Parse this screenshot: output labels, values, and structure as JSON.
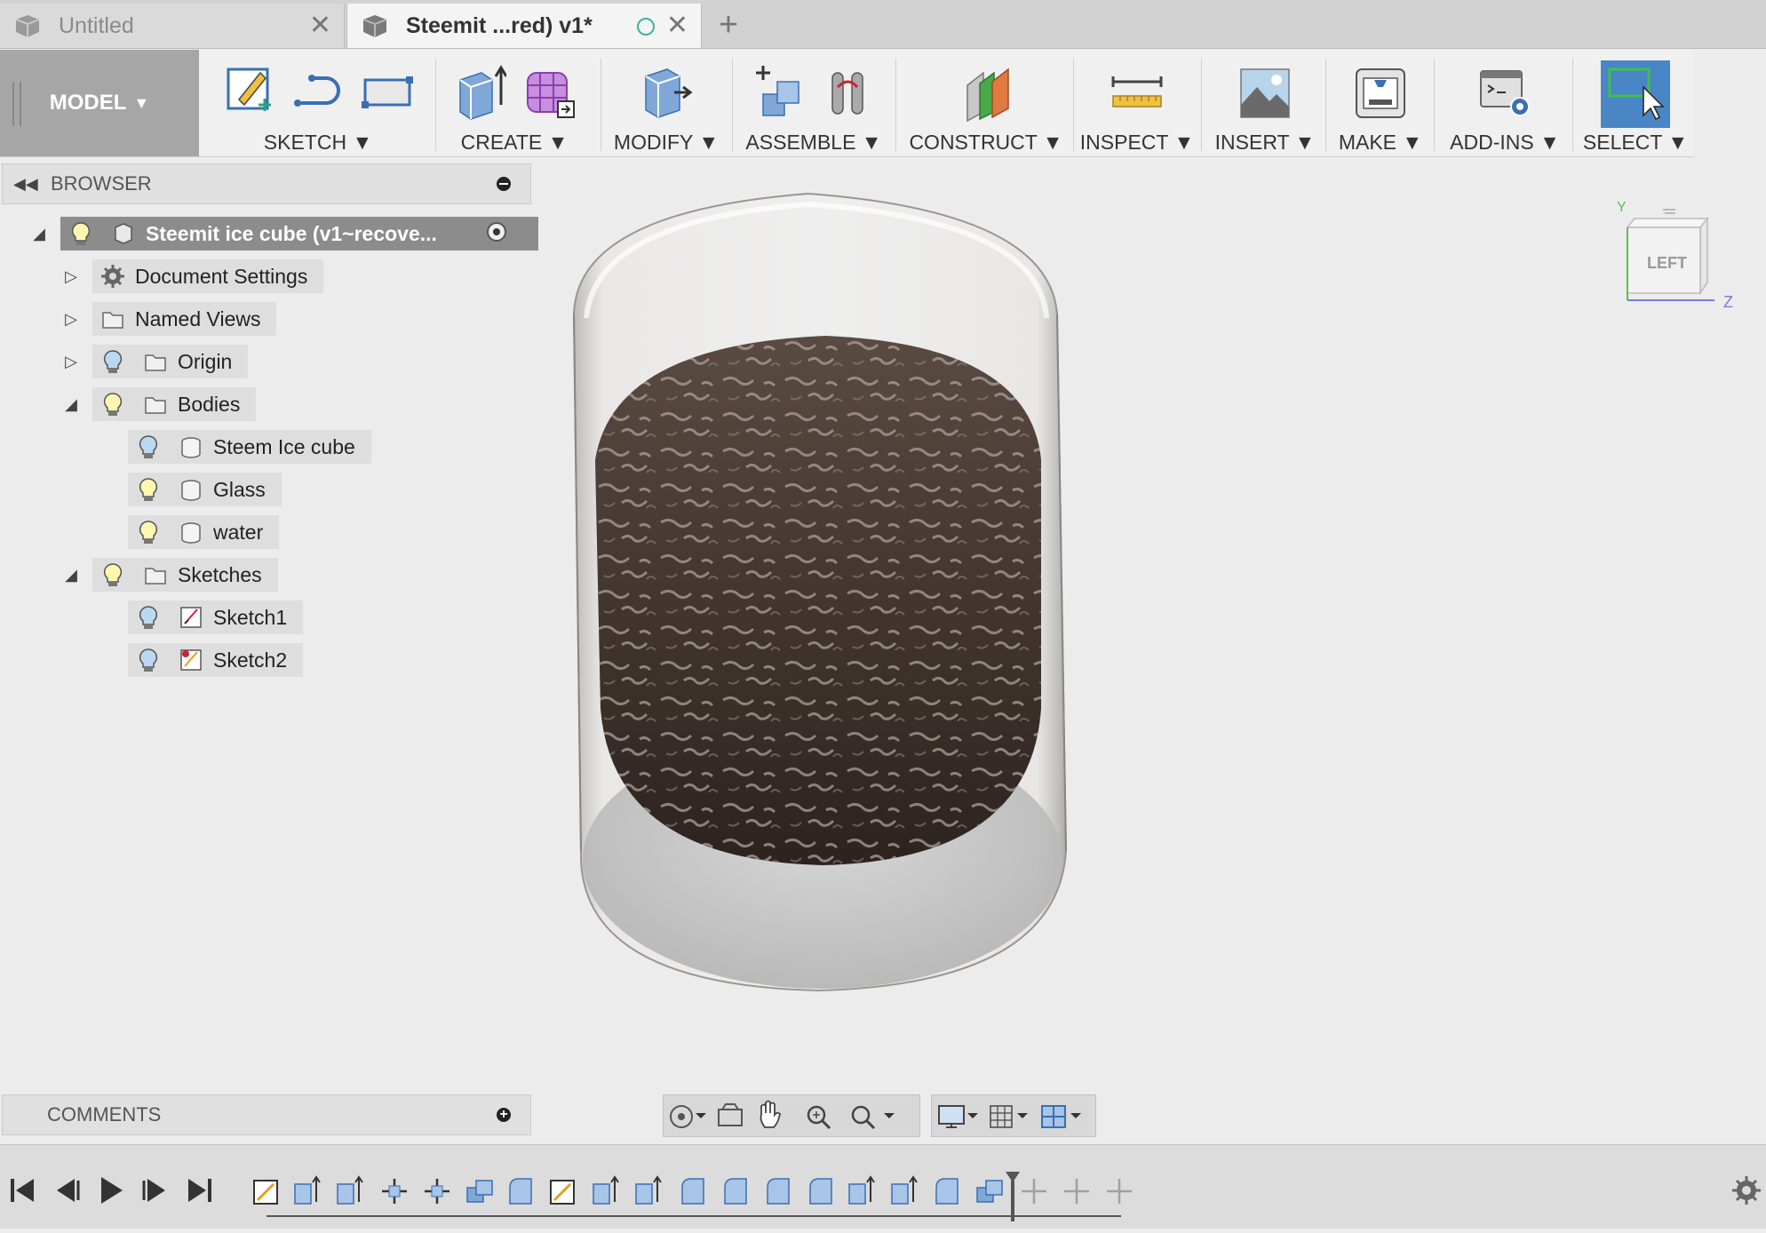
{
  "tabs": [
    {
      "label": "Untitled",
      "active": false
    },
    {
      "label": "Steemit ...red) v1*",
      "active": true
    }
  ],
  "toolbar": {
    "workspace": "MODEL",
    "groups": [
      "SKETCH",
      "CREATE",
      "MODIFY",
      "ASSEMBLE",
      "CONSTRUCT",
      "INSPECT",
      "INSERT",
      "MAKE",
      "ADD-INS",
      "SELECT"
    ]
  },
  "browser": {
    "title": "BROWSER",
    "root": "Steemit ice cube (v1~recove...",
    "items": {
      "document_settings": "Document Settings",
      "named_views": "Named Views",
      "origin": "Origin",
      "bodies": "Bodies",
      "steem_ice_cube": "Steem Ice cube",
      "glass": "Glass",
      "water": "water",
      "sketches": "Sketches",
      "sketch1": "Sketch1",
      "sketch2": "Sketch2"
    }
  },
  "comments": {
    "title": "COMMENTS"
  },
  "viewcube": {
    "face": "LEFT",
    "axis_y": "Y",
    "axis_z": "Z"
  },
  "colors": {
    "accent_select": "#4a86c5",
    "model_bg": "#a6a6a6",
    "root_bg": "#8c8c8c"
  }
}
